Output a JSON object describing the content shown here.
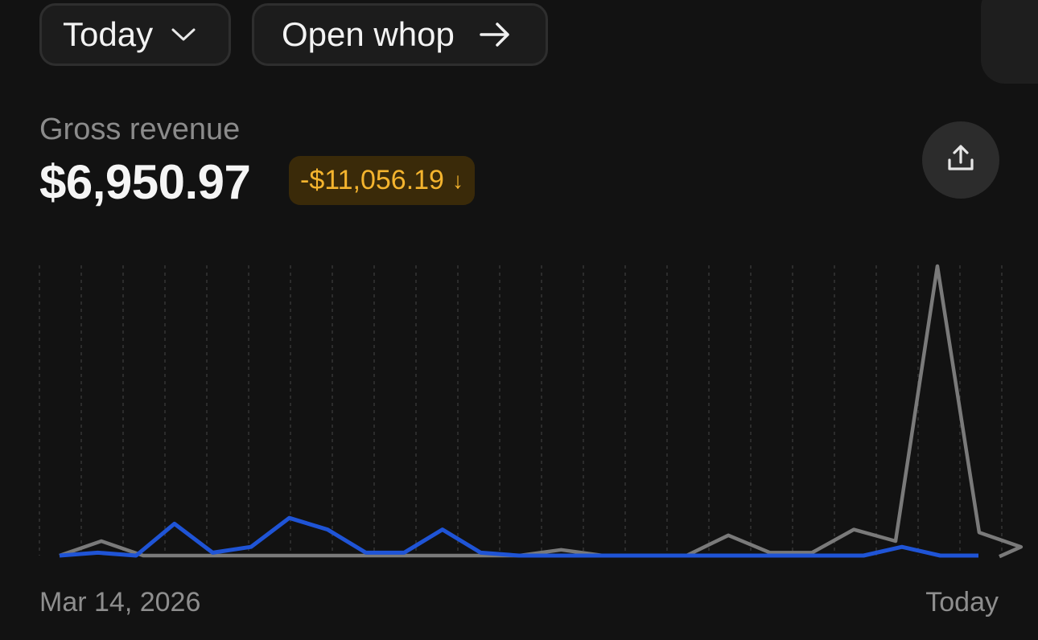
{
  "controls": {
    "range_label": "Today",
    "open_label": "Open whop"
  },
  "metric": {
    "label": "Gross revenue",
    "value": "$6,950.97",
    "delta": "-$11,056.19",
    "delta_arrow": "↓"
  },
  "icons": {
    "range_dropdown": "chevron-down-icon",
    "open_whop": "arrow-right-icon",
    "share": "share-icon"
  },
  "colors": {
    "current_series": "#1f54d6",
    "previous_series": "#7a7a7a",
    "delta_text": "#f4b42e",
    "delta_background": "#3a2a09"
  },
  "chart_data": {
    "type": "line",
    "x_start_label": "Mar 14, 2026",
    "x_end_label": "Today",
    "grid": "vertical dashed",
    "ylim": [
      0,
      100
    ],
    "series": [
      {
        "values": [
          0,
          1,
          0,
          11,
          1,
          3,
          13,
          9,
          1,
          1,
          9,
          1,
          0,
          0,
          0,
          0,
          0,
          0,
          0,
          0,
          0,
          0,
          3,
          0,
          0
        ]
      },
      {
        "values": [
          0,
          5,
          0,
          0,
          0,
          0,
          0,
          0,
          0,
          0,
          0,
          0,
          2,
          0,
          0,
          0,
          7,
          1,
          1,
          9,
          5,
          100,
          8,
          3
        ]
      }
    ]
  }
}
